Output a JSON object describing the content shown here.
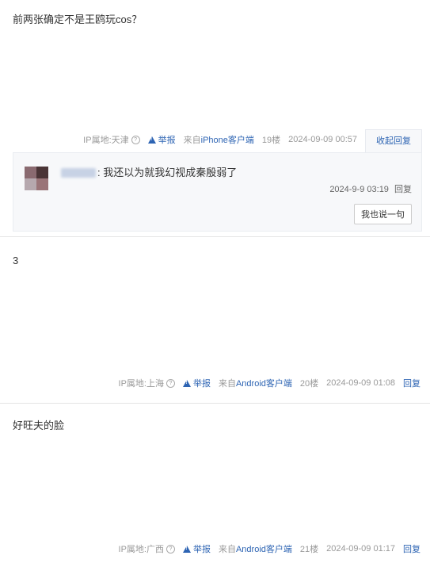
{
  "posts": [
    {
      "content": "前两张确定不是王鸥玩cos？",
      "ip_label": "IP属地:天津",
      "help_glyph": "?",
      "report_label": "举报",
      "source_prefix": "来自",
      "source_client": "iPhone客户端",
      "floor": "19楼",
      "time": "2024-09-09 00:57",
      "reply_action": "收起回复",
      "sub_replies": [
        {
          "separator": ":",
          "text": "我还以为就我幻视成秦殷弱了",
          "time": "2024-9-9 03:19",
          "reply_label": "回复"
        }
      ],
      "say_button": "我也说一句"
    },
    {
      "content": "3",
      "ip_label": "IP属地:上海",
      "help_glyph": "?",
      "report_label": "举报",
      "source_prefix": "来自",
      "source_client": "Android客户端",
      "floor": "20楼",
      "time": "2024-09-09 01:08",
      "reply_action": "回复"
    },
    {
      "content": "好旺夫的脸",
      "ip_label": "IP属地:广西",
      "help_glyph": "?",
      "report_label": "举报",
      "source_prefix": "来自",
      "source_client": "Android客户端",
      "floor": "21楼",
      "time": "2024-09-09 01:17",
      "reply_action": "回复"
    }
  ],
  "colors": {
    "link": "#2d64b3",
    "meta_gray": "#999999",
    "subbox_bg": "#f7f8fa"
  },
  "icons": {
    "help": "question-circle-icon",
    "report": "warning-triangle-icon"
  }
}
